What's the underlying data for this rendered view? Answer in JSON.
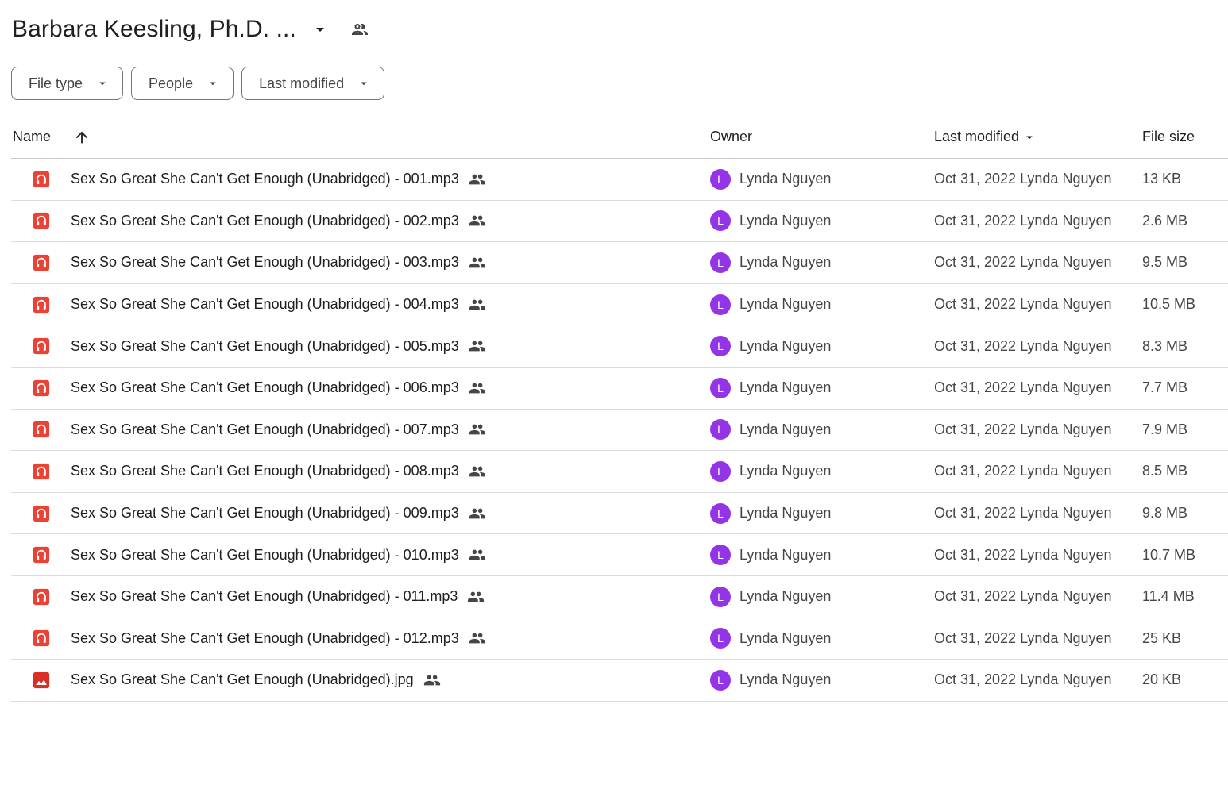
{
  "header": {
    "folder_title": "Barbara Keesling, Ph.D. ...",
    "caret_icon": "arrow-drop-down-icon",
    "shared_icon": "shared-folder-icon"
  },
  "filters": [
    {
      "label": "File type"
    },
    {
      "label": "People"
    },
    {
      "label": "Last modified"
    }
  ],
  "columns": {
    "name": "Name",
    "owner": "Owner",
    "last_modified": "Last modified",
    "file_size": "File size"
  },
  "colors": {
    "audio_icon": "#ea4335",
    "image_icon": "#d93025",
    "avatar": "#9334e6"
  },
  "files": [
    {
      "name": "Sex So Great She Can't Get Enough (Unabridged) - 001.mp3",
      "type": "audio",
      "owner": "Lynda Nguyen",
      "owner_initial": "L",
      "modified": "Oct 31, 2022 Lynda Nguyen",
      "size": "13 KB"
    },
    {
      "name": "Sex So Great She Can't Get Enough (Unabridged) - 002.mp3",
      "type": "audio",
      "owner": "Lynda Nguyen",
      "owner_initial": "L",
      "modified": "Oct 31, 2022 Lynda Nguyen",
      "size": "2.6 MB"
    },
    {
      "name": "Sex So Great She Can't Get Enough (Unabridged) - 003.mp3",
      "type": "audio",
      "owner": "Lynda Nguyen",
      "owner_initial": "L",
      "modified": "Oct 31, 2022 Lynda Nguyen",
      "size": "9.5 MB"
    },
    {
      "name": "Sex So Great She Can't Get Enough (Unabridged) - 004.mp3",
      "type": "audio",
      "owner": "Lynda Nguyen",
      "owner_initial": "L",
      "modified": "Oct 31, 2022 Lynda Nguyen",
      "size": "10.5 MB"
    },
    {
      "name": "Sex So Great She Can't Get Enough (Unabridged) - 005.mp3",
      "type": "audio",
      "owner": "Lynda Nguyen",
      "owner_initial": "L",
      "modified": "Oct 31, 2022 Lynda Nguyen",
      "size": "8.3 MB"
    },
    {
      "name": "Sex So Great She Can't Get Enough (Unabridged) - 006.mp3",
      "type": "audio",
      "owner": "Lynda Nguyen",
      "owner_initial": "L",
      "modified": "Oct 31, 2022 Lynda Nguyen",
      "size": "7.7 MB"
    },
    {
      "name": "Sex So Great She Can't Get Enough (Unabridged) - 007.mp3",
      "type": "audio",
      "owner": "Lynda Nguyen",
      "owner_initial": "L",
      "modified": "Oct 31, 2022 Lynda Nguyen",
      "size": "7.9 MB"
    },
    {
      "name": "Sex So Great She Can't Get Enough (Unabridged) - 008.mp3",
      "type": "audio",
      "owner": "Lynda Nguyen",
      "owner_initial": "L",
      "modified": "Oct 31, 2022 Lynda Nguyen",
      "size": "8.5 MB"
    },
    {
      "name": "Sex So Great She Can't Get Enough (Unabridged) - 009.mp3",
      "type": "audio",
      "owner": "Lynda Nguyen",
      "owner_initial": "L",
      "modified": "Oct 31, 2022 Lynda Nguyen",
      "size": "9.8 MB"
    },
    {
      "name": "Sex So Great She Can't Get Enough (Unabridged) - 010.mp3",
      "type": "audio",
      "owner": "Lynda Nguyen",
      "owner_initial": "L",
      "modified": "Oct 31, 2022 Lynda Nguyen",
      "size": "10.7 MB"
    },
    {
      "name": "Sex So Great She Can't Get Enough (Unabridged) - 011.mp3",
      "type": "audio",
      "owner": "Lynda Nguyen",
      "owner_initial": "L",
      "modified": "Oct 31, 2022 Lynda Nguyen",
      "size": "11.4 MB"
    },
    {
      "name": "Sex So Great She Can't Get Enough (Unabridged) - 012.mp3",
      "type": "audio",
      "owner": "Lynda Nguyen",
      "owner_initial": "L",
      "modified": "Oct 31, 2022 Lynda Nguyen",
      "size": "25 KB"
    },
    {
      "name": "Sex So Great She Can't Get Enough (Unabridged).jpg",
      "type": "image",
      "owner": "Lynda Nguyen",
      "owner_initial": "L",
      "modified": "Oct 31, 2022 Lynda Nguyen",
      "size": "20 KB"
    }
  ]
}
